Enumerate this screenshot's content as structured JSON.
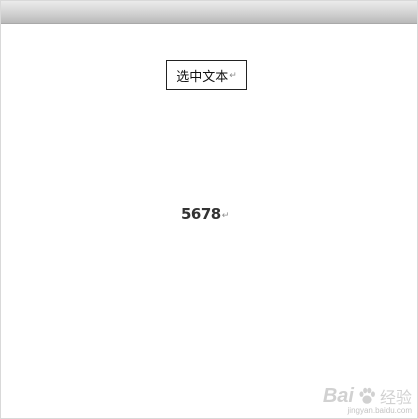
{
  "document": {
    "textbox": {
      "label": "选中文本",
      "paragraph_mark": "↵"
    },
    "number_line": {
      "text": "5678",
      "paragraph_mark": "↵"
    }
  },
  "watermark": {
    "logo": "Bai",
    "icon": "paw-icon",
    "suffix": "经验",
    "url": "jingyan.baidu.com"
  }
}
